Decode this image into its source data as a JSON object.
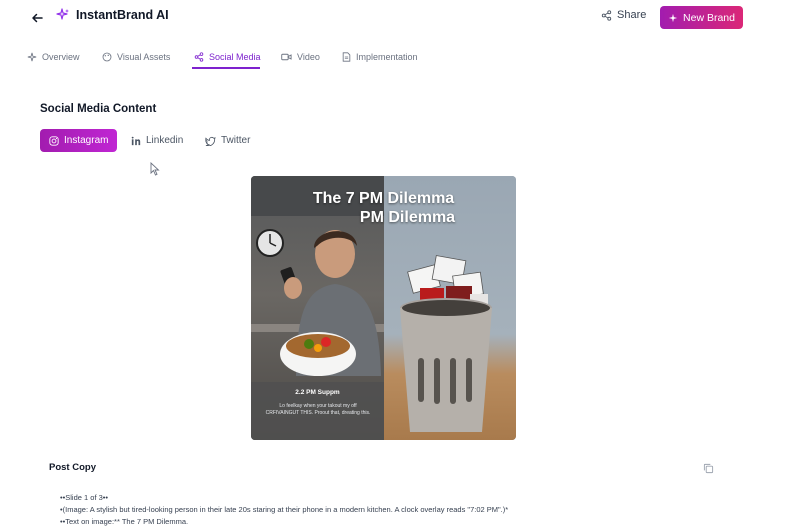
{
  "header": {
    "title": "InstantBrand AI",
    "share_label": "Share",
    "new_brand_label": "New Brand"
  },
  "tabs": [
    {
      "label": "Overview",
      "icon": "sparkle-icon"
    },
    {
      "label": "Visual Assets",
      "icon": "palette-icon"
    },
    {
      "label": "Social Media",
      "icon": "share-icon",
      "active": true
    },
    {
      "label": "Video",
      "icon": "video-icon"
    },
    {
      "label": "Implementation",
      "icon": "document-icon"
    }
  ],
  "social": {
    "section_title": "Social Media Content",
    "platforms": [
      {
        "label": "Instagram",
        "active": true
      },
      {
        "label": "Linkedin"
      },
      {
        "label": "Twitter"
      }
    ]
  },
  "post_image": {
    "title_line1": "The 7 PM Dilemma",
    "title_line2": "PM Dilemma",
    "caption_title": "2.2 PM Suppm",
    "caption_text": "Lo feelkay when your takout my off CRFIVAINGUT THIS. Proout that, dreating this."
  },
  "post_copy": {
    "title": "Post Copy",
    "lines": [
      "••Slide 1 of 3••",
      "•(Image: A stylish but tired-looking person in their late 20s staring at their phone in a modern kitchen. A clock overlay reads \"7:02 PM\".)*",
      "••Text on image:** The 7 PM Dilemma."
    ]
  },
  "colors": {
    "accent": "#7e22ce",
    "gradient_start": "#a21caf",
    "gradient_end": "#db2777"
  }
}
